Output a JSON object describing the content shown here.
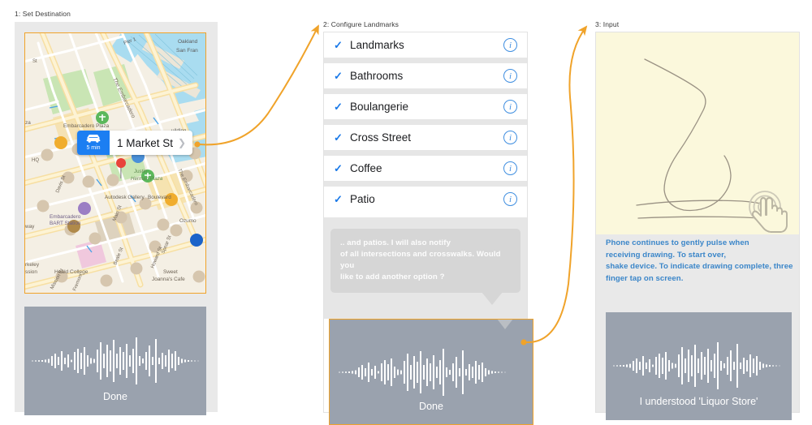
{
  "panels": [
    {
      "label": "1: Set Destination",
      "map": {
        "callout": {
          "eta": "5 min",
          "car_icon": "car-icon",
          "destination": "1 Market St",
          "chevron": "chevron-right-icon"
        },
        "labels": [
          "Oakland",
          "San Fran",
          "Pier 1",
          "The Embarcadero",
          "Embarcadero Plaza",
          "Justin",
          "Herman Plaza",
          "Autodesk Gallery",
          "Boulevard",
          "Embarcadero",
          "BART Station",
          "Ozumo",
          "Main St",
          "Spear St",
          "Howard St",
          "Beale St",
          "Heald College",
          "Sweet",
          "Joanna's Cafe",
          "Mission St",
          "Fremont",
          "HQ",
          "way",
          "rkeley",
          "ssion",
          "St"
        ]
      },
      "waveform": {
        "caption": "Done"
      }
    },
    {
      "label": "2: Configure Landmarks",
      "list": [
        {
          "label": "Landmarks",
          "checked": true,
          "info": "i"
        },
        {
          "label": "Bathrooms",
          "checked": true,
          "info": "i"
        },
        {
          "label": "Boulangerie",
          "checked": true,
          "info": "i"
        },
        {
          "label": "Cross Street",
          "checked": true,
          "info": "i"
        },
        {
          "label": "Coffee",
          "checked": true,
          "info": "i"
        },
        {
          "label": "Patio",
          "checked": true,
          "info": "i"
        }
      ],
      "bubble": {
        "text": ".. and patios. I will also notify\nof all  intersections and crosswalks. Would you\nlike to add another option ?"
      },
      "waveform": {
        "caption": "Done"
      }
    },
    {
      "label": "3: Input",
      "instructions": "Phone continues to gently pulse when\nreceiving drawing. To start over,\nshake device. To indicate drawing complete, three\nfinger tap on screen.",
      "hand_icon": "tap-hand-icon",
      "waveform": {
        "caption": "I understood 'Liquor Store'"
      }
    }
  ],
  "colors": {
    "accent_orange": "#f0a32a",
    "link_blue": "#1878e8",
    "instruction_blue": "#3b86c9",
    "waveform_bg": "#9aa2ae",
    "canvas_cream": "#fbf8dc",
    "device_gray": "#e9e9e9"
  }
}
